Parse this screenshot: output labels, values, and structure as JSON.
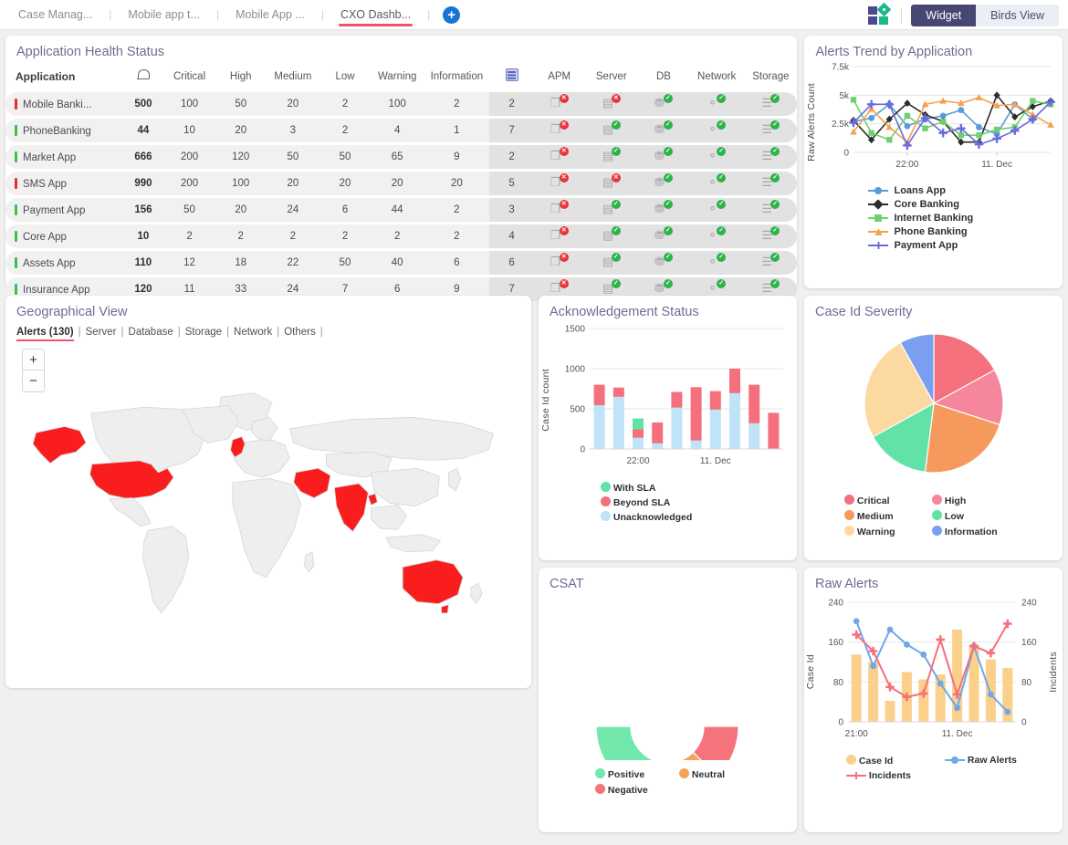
{
  "topbar": {
    "tabs": [
      {
        "label": "Case Manag...",
        "active": false
      },
      {
        "label": "Mobile app t...",
        "active": false
      },
      {
        "label": "Mobile App ...",
        "active": false
      },
      {
        "label": "CXO Dashb...",
        "active": true
      }
    ],
    "add_tab_label": "+",
    "logo_name": "app-logo",
    "view_toggle": {
      "widget": "Widget",
      "birds": "Birds View",
      "selected": "Widget"
    }
  },
  "health": {
    "title": "Application Health Status",
    "columns": [
      "Application",
      "bell-icon",
      "Critical",
      "High",
      "Medium",
      "Low",
      "Warning",
      "Information",
      "grid-icon",
      "APM",
      "Server",
      "DB",
      "Network",
      "Storage"
    ],
    "col_colors": {
      "Critical": "#f4526a",
      "High": "#f06292",
      "Medium": "#f6922e",
      "Low": "#52c97a",
      "Warning": "#c9a227",
      "Information": "#3d9be9"
    },
    "rows": [
      {
        "app": "Mobile Banki...",
        "status": "red",
        "alerts": "500",
        "critical": "100",
        "high": "50",
        "medium": "20",
        "low": "2",
        "warning": "100",
        "information": "2",
        "cases": "2",
        "apm": "bad",
        "server": "bad",
        "db": "ok",
        "network": "ok",
        "storage": "ok"
      },
      {
        "app": "PhoneBanking",
        "status": "green",
        "alerts": "44",
        "critical": "10",
        "high": "20",
        "medium": "3",
        "low": "2",
        "warning": "4",
        "information": "1",
        "cases": "7",
        "apm": "bad",
        "server": "ok",
        "db": "ok",
        "network": "ok",
        "storage": "ok"
      },
      {
        "app": "Market App",
        "status": "green",
        "alerts": "666",
        "critical": "200",
        "high": "120",
        "medium": "50",
        "low": "50",
        "warning": "65",
        "information": "9",
        "cases": "2",
        "apm": "bad",
        "server": "ok",
        "db": "ok",
        "network": "ok",
        "storage": "ok"
      },
      {
        "app": "SMS App",
        "status": "red",
        "alerts": "990",
        "critical": "200",
        "high": "100",
        "medium": "20",
        "low": "20",
        "warning": "20",
        "information": "20",
        "cases": "5",
        "apm": "bad",
        "server": "bad",
        "db": "ok",
        "network": "ok",
        "storage": "ok"
      },
      {
        "app": "Payment App",
        "status": "green",
        "alerts": "156",
        "critical": "50",
        "high": "20",
        "medium": "24",
        "low": "6",
        "warning": "44",
        "information": "2",
        "cases": "3",
        "apm": "bad",
        "server": "ok",
        "db": "ok",
        "network": "ok",
        "storage": "ok"
      },
      {
        "app": "Core App",
        "status": "green",
        "alerts": "10",
        "critical": "2",
        "high": "2",
        "medium": "2",
        "low": "2",
        "warning": "2",
        "information": "2",
        "cases": "4",
        "apm": "bad",
        "server": "ok",
        "db": "ok",
        "network": "ok",
        "storage": "ok"
      },
      {
        "app": "Assets App",
        "status": "green",
        "alerts": "110",
        "critical": "12",
        "high": "18",
        "medium": "22",
        "low": "50",
        "warning": "40",
        "information": "6",
        "cases": "6",
        "apm": "bad",
        "server": "ok",
        "db": "ok",
        "network": "ok",
        "storage": "ok"
      },
      {
        "app": "Insurance App",
        "status": "green",
        "alerts": "120",
        "critical": "11",
        "high": "33",
        "medium": "24",
        "low": "7",
        "warning": "6",
        "information": "9",
        "cases": "7",
        "apm": "bad",
        "server": "ok",
        "db": "ok",
        "network": "ok",
        "storage": "ok"
      }
    ]
  },
  "geo": {
    "title": "Geographical View",
    "tabs": [
      "Alerts (130)",
      "Server",
      "Database",
      "Storage",
      "Network",
      "Others"
    ],
    "active_tab": "Alerts (130)",
    "zoom_in": "+",
    "zoom_out": "−",
    "highlighted_regions": [
      "United States",
      "Alaska",
      "United Kingdom",
      "Iran",
      "Iraq",
      "India",
      "Australia"
    ],
    "highlight_color": "#f91d1d",
    "base_color": "#eeeeee"
  },
  "chart_data": [
    {
      "id": "alerts_trend",
      "type": "line",
      "title": "Alerts Trend by Application",
      "xlabel": "",
      "ylabel": "Raw Alerts Count",
      "ylim": [
        0,
        7500
      ],
      "yticks": [
        0,
        2500,
        5000,
        7500
      ],
      "ytick_labels": [
        "0",
        "2.5k",
        "5k",
        "7.5k"
      ],
      "xtick_labels": [
        "22:00",
        "11. Dec"
      ],
      "xtick_positions": [
        3,
        8
      ],
      "grid": true,
      "legend_position": "bottom",
      "x": [
        0,
        1,
        2,
        3,
        4,
        5,
        6,
        7,
        8,
        9,
        10,
        11
      ],
      "series": [
        {
          "name": "Loans App",
          "color": "#5b9bd5",
          "marker": "circle",
          "values": [
            2700,
            3000,
            4200,
            2300,
            2900,
            3200,
            3700,
            2200,
            1600,
            4200,
            2900,
            4400
          ]
        },
        {
          "name": "Core Banking",
          "color": "#2d2d2d",
          "marker": "diamond",
          "values": [
            2800,
            1100,
            2900,
            4300,
            3300,
            2700,
            900,
            900,
            5000,
            3100,
            4000,
            4500
          ]
        },
        {
          "name": "Internet Banking",
          "color": "#6fd06f",
          "marker": "square",
          "values": [
            4600,
            1700,
            1100,
            3200,
            2100,
            2700,
            1500,
            1500,
            2000,
            2200,
            4500,
            4200
          ]
        },
        {
          "name": "Phone Banking",
          "color": "#f5a04d",
          "marker": "triangle",
          "values": [
            1800,
            3800,
            2200,
            900,
            4200,
            4500,
            4300,
            4800,
            4100,
            4200,
            3300,
            2400
          ]
        },
        {
          "name": "Payment App",
          "color": "#6a6adf",
          "marker": "cross",
          "values": [
            2600,
            4200,
            4200,
            600,
            3000,
            1700,
            2100,
            700,
            1200,
            1900,
            2900,
            4400
          ]
        }
      ]
    },
    {
      "id": "acknowledgement_status",
      "type": "bar",
      "stacked": true,
      "title": "Acknowledgement Status",
      "xlabel": "",
      "ylabel": "Case Id count",
      "ylim": [
        0,
        1500
      ],
      "yticks": [
        0,
        500,
        1000,
        1500
      ],
      "ytick_labels": [
        "0",
        "500",
        "1000",
        "1500"
      ],
      "xtick_labels": [
        "22:00",
        "11. Dec"
      ],
      "xtick_positions": [
        2,
        6
      ],
      "grid": true,
      "legend_position": "bottom",
      "categories": [
        "b1",
        "b2",
        "b3",
        "b4",
        "b5",
        "b6",
        "b7",
        "b8",
        "b9",
        "b10"
      ],
      "series": [
        {
          "name": "Unacknowledged",
          "color": "#bfe3f7",
          "values": [
            545,
            650,
            140,
            70,
            515,
            105,
            490,
            695,
            320,
            0
          ]
        },
        {
          "name": "Beyond SLA",
          "color": "#f4707c",
          "values": [
            255,
            115,
            105,
            260,
            195,
            665,
            230,
            305,
            480,
            450
          ]
        },
        {
          "name": "With SLA",
          "color": "#63e2a8",
          "values": [
            0,
            0,
            135,
            0,
            0,
            0,
            0,
            0,
            0,
            0
          ]
        }
      ]
    },
    {
      "id": "case_id_severity",
      "type": "pie",
      "title": "Case Id Severity",
      "legend_position": "bottom",
      "labels": [
        "Critical",
        "High",
        "Medium",
        "Low",
        "Warning",
        "Information"
      ],
      "values": [
        17,
        13,
        22,
        15,
        25,
        8
      ],
      "colors": [
        "#f4707c",
        "#f5869b",
        "#f59a5c",
        "#63e2a8",
        "#fbd9a0",
        "#7a9ef0"
      ]
    },
    {
      "id": "csat",
      "type": "pie",
      "variant": "gauge-donut-semicircle",
      "title": "CSAT",
      "legend_position": "bottom",
      "labels": [
        "Positive",
        "Neutral",
        "Negative"
      ],
      "values": [
        62,
        13,
        25
      ],
      "colors": [
        "#72e8ad",
        "#f5a45c",
        "#f5737b"
      ]
    },
    {
      "id": "raw_alerts",
      "type": "bar",
      "title": "Raw Alerts",
      "ylabel": "Case Id",
      "ylabel_right": "Incidents",
      "ylim": [
        0,
        240
      ],
      "yticks": [
        0,
        80,
        160,
        240
      ],
      "ytick_labels": [
        "0",
        "80",
        "160",
        "240"
      ],
      "ytick_labels_right": [
        "0",
        "80",
        "160",
        "240"
      ],
      "xtick_labels": [
        "21:00",
        "11. Dec"
      ],
      "xtick_positions": [
        0,
        6
      ],
      "grid": true,
      "legend_position": "bottom",
      "categories": [
        "p1",
        "p2",
        "p3",
        "p4",
        "p5",
        "p6",
        "p7",
        "p8",
        "p9",
        "p10"
      ],
      "series": [
        {
          "name": "Case Id",
          "type": "bar",
          "color": "#fbd08a",
          "values": [
            135,
            120,
            42,
            100,
            85,
            95,
            185,
            155,
            125,
            108
          ]
        },
        {
          "name": "Raw Alerts",
          "type": "line",
          "color": "#6ea8e8",
          "marker": "circle",
          "values": [
            202,
            112,
            185,
            155,
            135,
            77,
            28,
            152,
            55,
            20
          ]
        },
        {
          "name": "Incidents",
          "type": "line",
          "color": "#f4707c",
          "marker": "cross",
          "values": [
            175,
            142,
            70,
            50,
            57,
            165,
            55,
            152,
            138,
            197
          ]
        }
      ]
    }
  ]
}
